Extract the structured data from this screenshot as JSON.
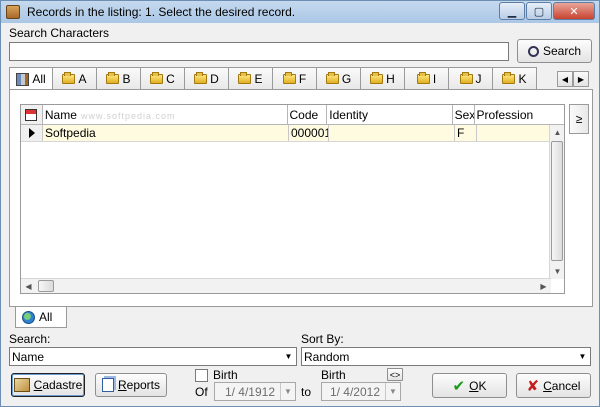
{
  "window": {
    "title": "Records in the listing:  1. Select the desired record.",
    "controls": {
      "minimize": "▁",
      "maximize": "▢",
      "close": "✕"
    }
  },
  "search": {
    "label": "Search Characters",
    "value": "",
    "button_label": "Search"
  },
  "letter_tabs": [
    "All",
    "A",
    "B",
    "C",
    "D",
    "E",
    "F",
    "G",
    "H",
    "I",
    "J",
    "K"
  ],
  "grid": {
    "watermark": "www.softpedia.com",
    "side_tab_label": "≥",
    "columns": [
      "Name",
      "Code",
      "Identity",
      "Sex",
      "Profession"
    ],
    "rows": [
      {
        "name": "Softpedia",
        "code": "000001",
        "identity": "",
        "sex": "F",
        "profession": ""
      }
    ]
  },
  "bottom_tab": {
    "label": "All"
  },
  "filters": {
    "search_label": "Search:",
    "search_value": "Name",
    "sort_label": "Sort By:",
    "sort_value": "Random"
  },
  "footer": {
    "cadastre_prefix": "C",
    "cadastre_rest": "adastre",
    "reports_prefix": "R",
    "reports_rest": "eports",
    "birth_from_label": "Birth",
    "of_label": "Of",
    "date_from": "1/  4/1912",
    "to_label": "to",
    "birth_to_label": "Birth",
    "date_to": "1/  4/2012",
    "swap_label": "<>",
    "ok_prefix": "O",
    "ok_rest": "K",
    "cancel_prefix": "C",
    "cancel_rest": "ancel"
  },
  "colors": {
    "selected_row": "#fffbe0",
    "ok": "#1a9a1a",
    "cancel": "#c81a1a"
  }
}
